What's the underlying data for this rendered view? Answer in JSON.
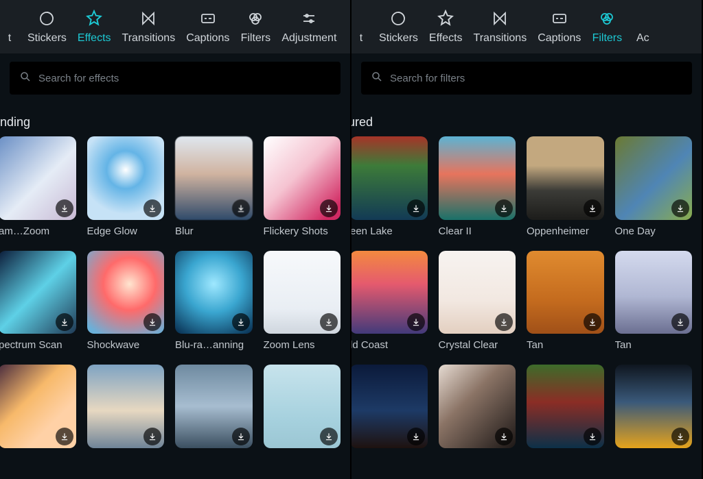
{
  "left": {
    "tabs": {
      "text_partial": "t",
      "stickers": "Stickers",
      "effects": "Effects",
      "transitions": "Transitions",
      "captions": "Captions",
      "filters": "Filters",
      "adjustment": "Adjustment"
    },
    "search": {
      "placeholder": "Search for effects"
    },
    "section": "ending",
    "items": [
      {
        "label": "am…Zoom"
      },
      {
        "label": "Edge Glow"
      },
      {
        "label": "Blur"
      },
      {
        "label": "Flickery Shots"
      },
      {
        "label": "pectrum Scan"
      },
      {
        "label": "Shockwave"
      },
      {
        "label": "Blu-ra…anning"
      },
      {
        "label": "Zoom Lens"
      },
      {
        "label": ""
      },
      {
        "label": ""
      },
      {
        "label": ""
      },
      {
        "label": ""
      }
    ]
  },
  "right": {
    "tabs": {
      "text_partial": "t",
      "stickers": "Stickers",
      "effects": "Effects",
      "transitions": "Transitions",
      "captions": "Captions",
      "filters": "Filters",
      "adjustment_partial": "Ac"
    },
    "search": {
      "placeholder": "Search for filters"
    },
    "section": "tured",
    "items": [
      {
        "label": "een Lake"
      },
      {
        "label": "Clear II"
      },
      {
        "label": "Oppenheimer"
      },
      {
        "label": "One Day"
      },
      {
        "label": "ld Coast"
      },
      {
        "label": "Crystal Clear"
      },
      {
        "label": "Tan"
      },
      {
        "label": "Tan"
      },
      {
        "label": ""
      },
      {
        "label": ""
      },
      {
        "label": ""
      },
      {
        "label": ""
      }
    ]
  }
}
